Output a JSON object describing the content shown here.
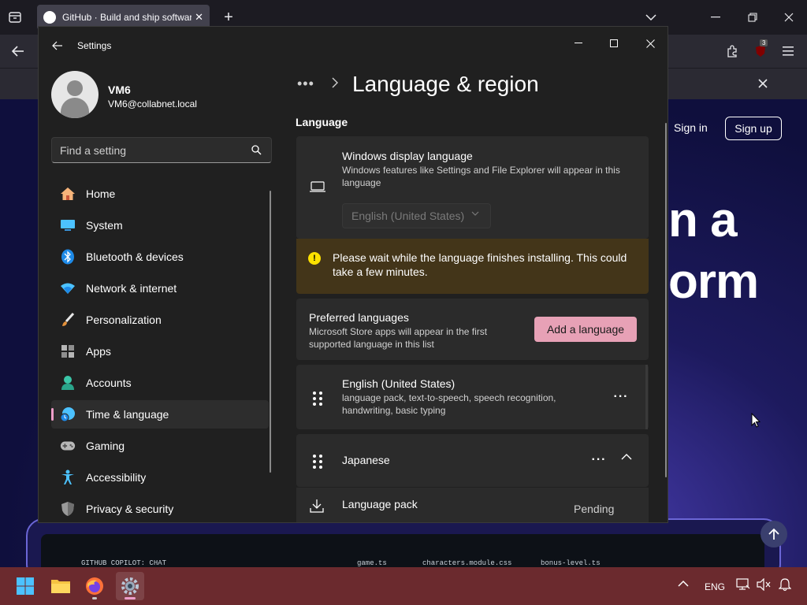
{
  "browser": {
    "tab_title": "GitHub · Build and ship software",
    "toolbar_badge": "3"
  },
  "github": {
    "sign_in": "Sign in",
    "sign_up": "Sign up",
    "hero_line1": "n a",
    "hero_line2": "orm",
    "mock_chat_label": "GITHUB COPILOT: CHAT",
    "mock_tabs": [
      "game.ts",
      "characters.module.css",
      "bonus-level.ts"
    ]
  },
  "settings": {
    "window_title": "Settings",
    "profile": {
      "name": "VM6",
      "email": "VM6@collabnet.local"
    },
    "search": {
      "placeholder": "Find a setting"
    },
    "nav": [
      {
        "label": "Home",
        "icon": "home-icon",
        "selected": false
      },
      {
        "label": "System",
        "icon": "system-icon",
        "selected": false
      },
      {
        "label": "Bluetooth & devices",
        "icon": "bluetooth-icon",
        "selected": false
      },
      {
        "label": "Network & internet",
        "icon": "wifi-icon",
        "selected": false
      },
      {
        "label": "Personalization",
        "icon": "brush-icon",
        "selected": false
      },
      {
        "label": "Apps",
        "icon": "apps-icon",
        "selected": false
      },
      {
        "label": "Accounts",
        "icon": "accounts-icon",
        "selected": false
      },
      {
        "label": "Time & language",
        "icon": "time-language-icon",
        "selected": true
      },
      {
        "label": "Gaming",
        "icon": "gaming-icon",
        "selected": false
      },
      {
        "label": "Accessibility",
        "icon": "accessibility-icon",
        "selected": false
      },
      {
        "label": "Privacy & security",
        "icon": "shield-icon",
        "selected": false
      }
    ],
    "breadcrumb_more": "•••",
    "page_title": "Language & region",
    "section_label": "Language",
    "display_language": {
      "title": "Windows display language",
      "description": "Windows features like Settings and File Explorer will appear in this language",
      "selected": "English (United States)"
    },
    "warning": "Please wait while the language finishes installing. This could take a few minutes.",
    "preferred": {
      "title": "Preferred languages",
      "description": "Microsoft Store apps will appear in the first supported language in this list",
      "add_button": "Add a language"
    },
    "languages": [
      {
        "name": "English (United States)",
        "features": "language pack, text-to-speech, speech recognition, handwriting, basic typing"
      },
      {
        "name": "Japanese"
      }
    ],
    "language_pack": {
      "label": "Language pack",
      "status": "Pending"
    }
  },
  "taskbar": {
    "lang": "ENG",
    "apps": [
      "windows-start-icon",
      "file-explorer-icon",
      "firefox-icon",
      "settings-icon"
    ]
  },
  "colors": {
    "accent": "#ee9ec9",
    "button": "#e7a1b6",
    "warning_bg": "#433519",
    "taskbar": "#6b2a2e"
  }
}
